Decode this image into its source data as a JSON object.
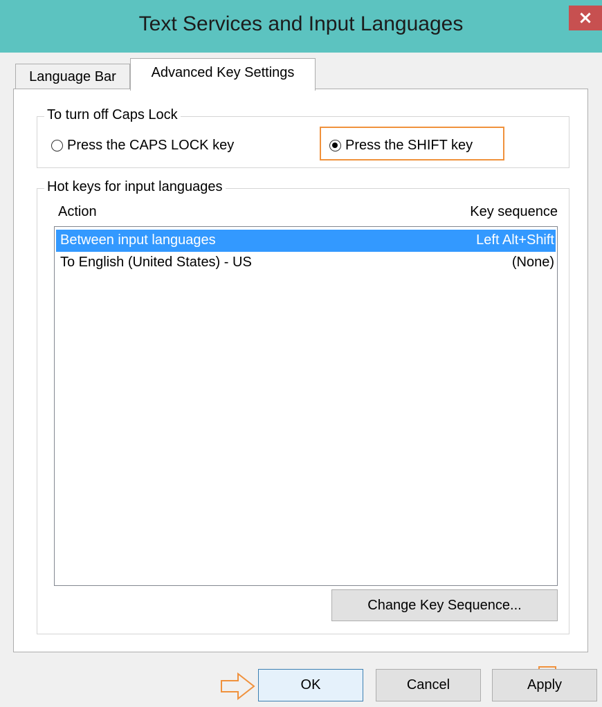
{
  "window": {
    "title": "Text Services and Input Languages",
    "close_glyph": "×"
  },
  "tabs": [
    {
      "label": "Language Bar",
      "active": false
    },
    {
      "label": "Advanced Key Settings",
      "active": true
    }
  ],
  "caps_lock": {
    "legend": "To turn off Caps Lock",
    "options": [
      {
        "label": "Press the CAPS LOCK key",
        "checked": false
      },
      {
        "label": "Press the SHIFT key",
        "checked": true
      }
    ]
  },
  "hotkeys": {
    "legend": "Hot keys for input languages",
    "columns": {
      "action": "Action",
      "key_sequence": "Key sequence"
    },
    "rows": [
      {
        "action": "Between input languages",
        "key_sequence": "Left Alt+Shift",
        "selected": true
      },
      {
        "action": "To English (United States) - US",
        "key_sequence": "(None)",
        "selected": false
      }
    ],
    "change_button": "Change Key Sequence..."
  },
  "footer": {
    "ok": "OK",
    "cancel": "Cancel",
    "apply": "Apply"
  },
  "colors": {
    "titlebar": "#5cc3c0",
    "close": "#c75050",
    "selection": "#3399ff",
    "annotation": "#f0913c"
  },
  "icons": [
    "close-icon",
    "arrow-right-icon",
    "arrow-down-icon"
  ]
}
